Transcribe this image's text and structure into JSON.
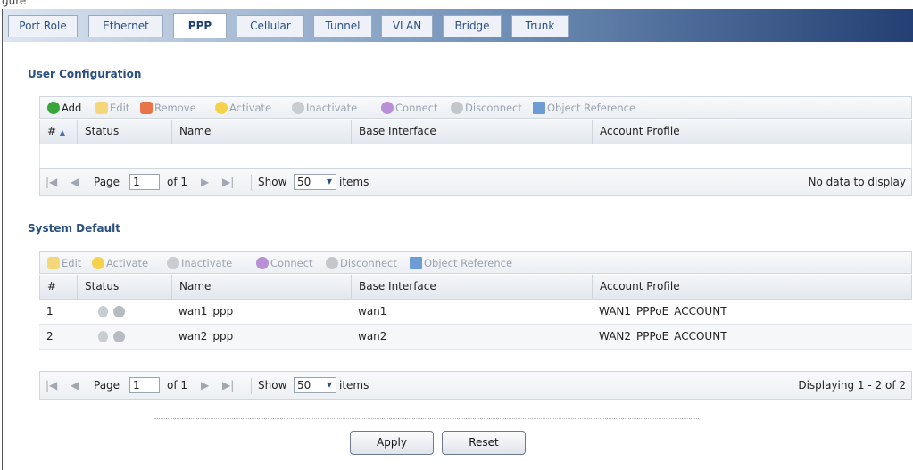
{
  "caption": "gure",
  "tabs": [
    "Port Role",
    "Ethernet",
    "PPP",
    "Cellular",
    "Tunnel",
    "VLAN",
    "Bridge",
    "Trunk"
  ],
  "active_tab": "PPP",
  "user_config": {
    "title": "User Configuration",
    "toolbar": {
      "add": "Add",
      "edit": "Edit",
      "remove": "Remove",
      "activate": "Activate",
      "inactivate": "Inactivate",
      "connect": "Connect",
      "disconnect": "Disconnect",
      "object_reference": "Object Reference"
    },
    "columns": {
      "num": "#",
      "sort": "▲",
      "status": "Status",
      "name": "Name",
      "base": "Base Interface",
      "profile": "Account Profile"
    },
    "pager": {
      "page_label": "Page",
      "page_value": "1",
      "of": "of 1",
      "show": "Show",
      "show_value": "50",
      "items": "items",
      "status": "No data to display"
    }
  },
  "system_default": {
    "title": "System Default",
    "toolbar": {
      "edit": "Edit",
      "activate": "Activate",
      "inactivate": "Inactivate",
      "connect": "Connect",
      "disconnect": "Disconnect",
      "object_reference": "Object Reference"
    },
    "columns": {
      "num": "#",
      "status": "Status",
      "name": "Name",
      "base": "Base Interface",
      "profile": "Account Profile"
    },
    "rows": [
      {
        "num": "1",
        "name": "wan1_ppp",
        "base": "wan1",
        "profile": "WAN1_PPPoE_ACCOUNT"
      },
      {
        "num": "2",
        "name": "wan2_ppp",
        "base": "wan2",
        "profile": "WAN2_PPPoE_ACCOUNT"
      }
    ],
    "pager": {
      "page_label": "Page",
      "page_value": "1",
      "of": "of 1",
      "show": "Show",
      "show_value": "50",
      "items": "items",
      "status": "Displaying 1 - 2 of 2"
    }
  },
  "buttons": {
    "apply": "Apply",
    "reset": "Reset"
  }
}
